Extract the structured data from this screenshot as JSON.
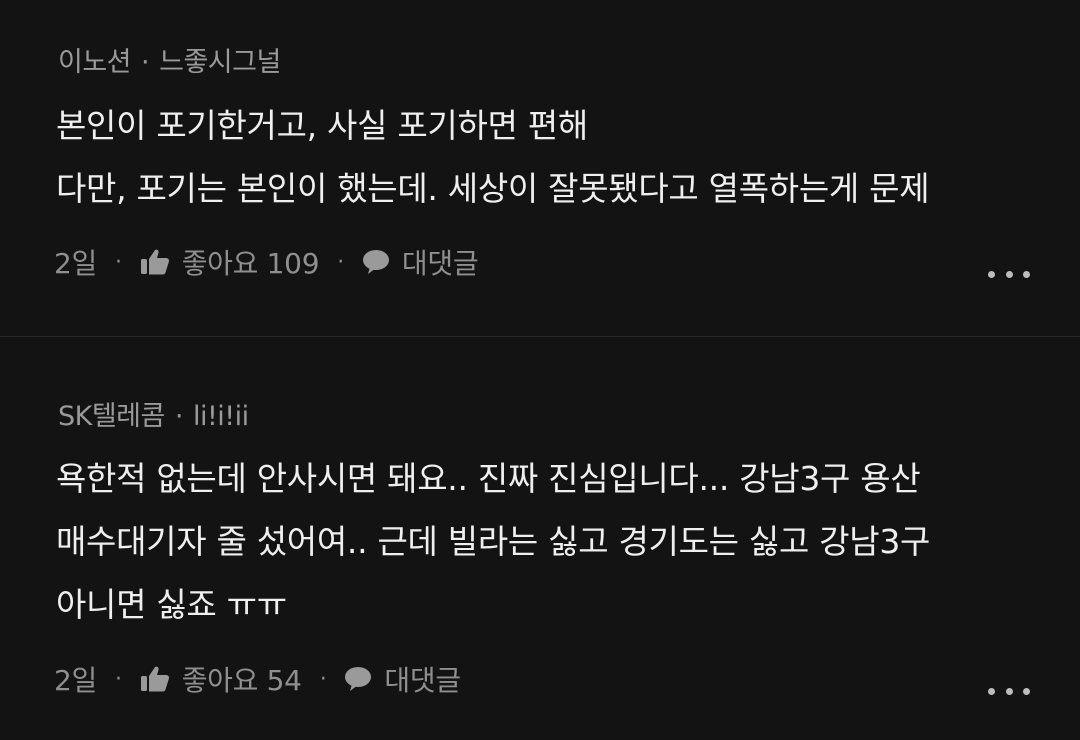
{
  "comments": [
    {
      "author": "이노션",
      "badge": "느좋시그널",
      "text": "본인이 포기한거고, 사실 포기하면 편해\n다만, 포기는 본인이 했는데. 세상이 잘못됐다고 열폭하는게 문제",
      "time": "2일",
      "like_label": "좋아요 109",
      "reply_label": "대댓글"
    },
    {
      "author": "SK텔레콤",
      "badge": "li!i!ii",
      "text": "욕한적 없는데 안사시면 돼요.. 진짜 진심입니다... 강남3구 용산\n매수대기자 줄 섰어여.. 근데 빌라는 싫고 경기도는 싫고 강남3구\n아니면 싫죠 ㅠㅠ",
      "time": "2일",
      "like_label": "좋아요 54",
      "reply_label": "대댓글"
    }
  ],
  "separator": "·",
  "icons": {
    "like": "thumbs-up-icon",
    "reply": "speech-bubble-icon",
    "more": "more-dots-icon"
  },
  "colors": {
    "background": "#131313",
    "text": "#efefef",
    "muted": "#8f8f8f"
  }
}
